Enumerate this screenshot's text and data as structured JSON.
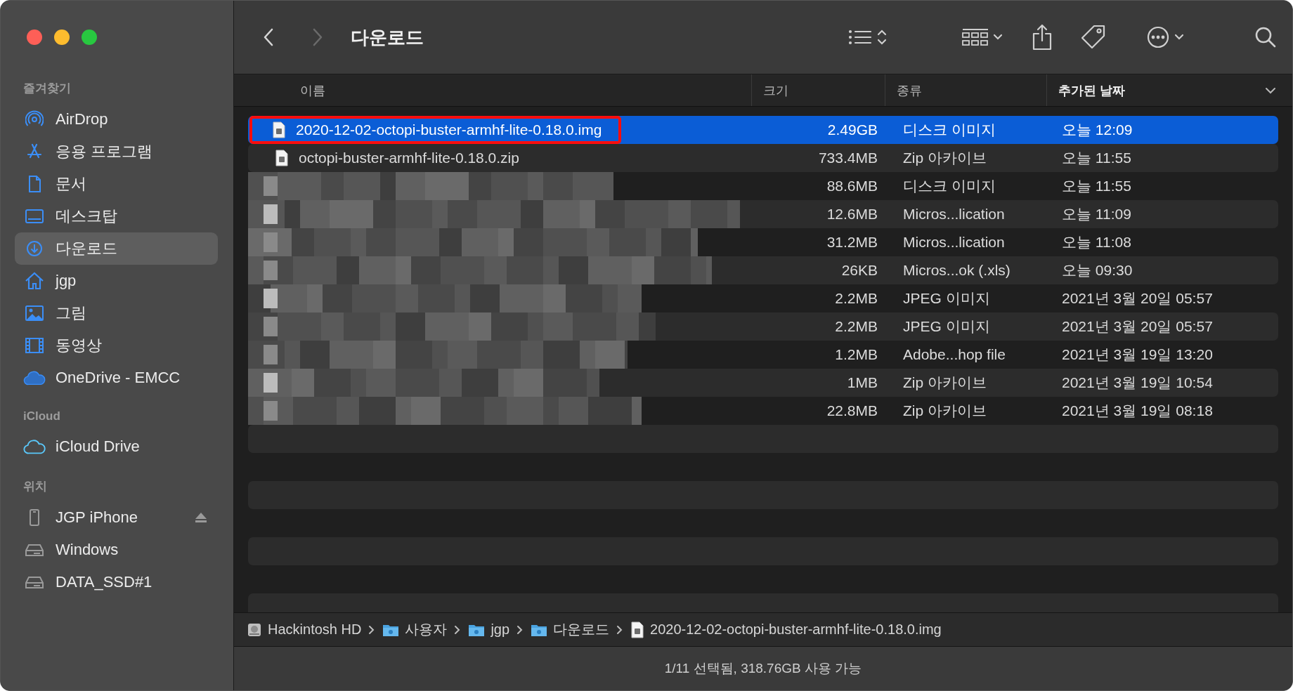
{
  "window": {
    "title": "다운로드"
  },
  "toolbar": {
    "back": {
      "disabled": false
    },
    "forward": {
      "disabled": true
    }
  },
  "sidebar": {
    "sections": [
      {
        "header": "즐겨찾기",
        "items": [
          {
            "label": "AirDrop",
            "selected": false
          },
          {
            "label": "응용 프로그램",
            "selected": false
          },
          {
            "label": "문서",
            "selected": false
          },
          {
            "label": "데스크탑",
            "selected": false
          },
          {
            "label": "다운로드",
            "selected": true
          },
          {
            "label": "jgp",
            "selected": false
          },
          {
            "label": "그림",
            "selected": false
          },
          {
            "label": "동영상",
            "selected": false
          },
          {
            "label": "OneDrive - EMCC",
            "selected": false
          }
        ]
      },
      {
        "header": "iCloud",
        "items": [
          {
            "label": "iCloud Drive",
            "selected": false
          }
        ]
      },
      {
        "header": "위치",
        "items": [
          {
            "label": "JGP iPhone",
            "selected": false,
            "ejectable": true
          },
          {
            "label": "Windows",
            "selected": false,
            "ejectable": false
          },
          {
            "label": "DATA_SSD#1",
            "selected": false,
            "ejectable": false
          }
        ]
      }
    ]
  },
  "table": {
    "columns": [
      {
        "label": "이름",
        "sorted": false
      },
      {
        "label": "크기",
        "sorted": false
      },
      {
        "label": "종류",
        "sorted": false
      },
      {
        "label": "추가된 날짜",
        "sorted": true
      }
    ],
    "rows": [
      {
        "kind": "file",
        "name": "2020-12-02-octopi-buster-armhf-lite-0.18.0.img",
        "size": "2.49GB",
        "type": "디스크 이미지",
        "date": "오늘 12:09",
        "selected": true,
        "outlined": true
      },
      {
        "kind": "file",
        "name": "octopi-buster-armhf-lite-0.18.0.zip",
        "size": "733.4MB",
        "type": "Zip 아카이브",
        "date": "오늘 11:55",
        "selected": false,
        "outlined": false
      },
      {
        "kind": "redacted",
        "size": "88.6MB",
        "type": "디스크 이미지",
        "date": "오늘 11:55",
        "selected": false,
        "outlined": false
      },
      {
        "kind": "redacted",
        "size": "12.6MB",
        "type": "Micros...lication",
        "date": "오늘 11:09",
        "selected": false,
        "outlined": false
      },
      {
        "kind": "redacted",
        "size": "31.2MB",
        "type": "Micros...lication",
        "date": "오늘 11:08",
        "selected": false,
        "outlined": false
      },
      {
        "kind": "redacted",
        "size": "26KB",
        "type": "Micros...ok (.xls)",
        "date": "오늘 09:30",
        "selected": false,
        "outlined": false
      },
      {
        "kind": "redacted",
        "size": "2.2MB",
        "type": "JPEG 이미지",
        "date": "2021년 3월 20일 05:57",
        "selected": false,
        "outlined": false
      },
      {
        "kind": "redacted",
        "size": "2.2MB",
        "type": "JPEG 이미지",
        "date": "2021년 3월 20일 05:57",
        "selected": false,
        "outlined": false
      },
      {
        "kind": "redacted",
        "size": "1.2MB",
        "type": "Adobe...hop file",
        "date": "2021년 3월 19일 13:20",
        "selected": false,
        "outlined": false
      },
      {
        "kind": "redacted",
        "size": "1MB",
        "type": "Zip 아카이브",
        "date": "2021년 3월 19일 10:54",
        "selected": false,
        "outlined": false
      },
      {
        "kind": "redacted",
        "size": "22.8MB",
        "type": "Zip 아카이브",
        "date": "2021년 3월 19일 08:18",
        "selected": false,
        "outlined": false
      }
    ]
  },
  "path_bar": [
    {
      "kind": "disk",
      "label": "Hackintosh HD"
    },
    {
      "kind": "folder",
      "label": "사용자"
    },
    {
      "kind": "folder",
      "label": "jgp"
    },
    {
      "kind": "folder",
      "label": "다운로드"
    },
    {
      "kind": "file",
      "label": "2020-12-02-octopi-buster-armhf-lite-0.18.0.img"
    }
  ],
  "status_bar": "1/11 선택됨, 318.76GB 사용 가능"
}
